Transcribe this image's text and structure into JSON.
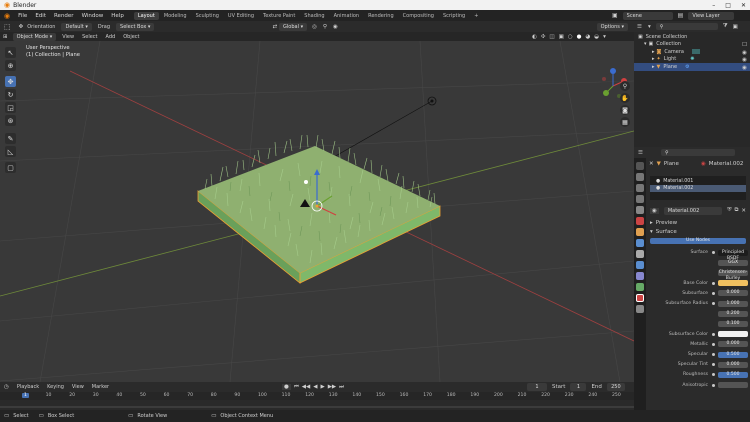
{
  "app": {
    "title": "Blender",
    "menus": [
      "File",
      "Edit",
      "Render",
      "Window",
      "Help"
    ],
    "workspaces": [
      "Layout",
      "Modeling",
      "Sculpting",
      "UV Editing",
      "Texture Paint",
      "Shading",
      "Animation",
      "Rendering",
      "Compositing",
      "Scripting"
    ],
    "active_workspace": "Layout",
    "add_workspace": "+",
    "scene": "Scene",
    "view_layer": "View Layer"
  },
  "viewport_header": {
    "orientation_label": "Orientation",
    "orientation_value": "Default",
    "drag_label": "Drag",
    "drag_value": "Select Box",
    "transform_value": "Global",
    "options": "Options",
    "mode": "Object Mode",
    "menus": [
      "View",
      "Select",
      "Add",
      "Object"
    ]
  },
  "viewport": {
    "perspective": "User Perspective",
    "collection_info": "(1) Collection | Plane"
  },
  "outliner": {
    "items": [
      {
        "label": "Scene Collection",
        "indent": 0
      },
      {
        "label": "Collection",
        "indent": 1
      },
      {
        "label": "Camera",
        "indent": 2
      },
      {
        "label": "Light",
        "indent": 2
      },
      {
        "label": "Plane",
        "indent": 2
      }
    ]
  },
  "properties": {
    "object_name": "Plane",
    "material_breadcrumb": "Material.002",
    "slots": [
      "Material.001",
      "Material.002"
    ],
    "material_name": "Material.002",
    "preview_label": "Preview",
    "surface_label": "Surface",
    "use_nodes": "Use Nodes",
    "rows": [
      {
        "label": "Surface",
        "value": "Principled BSDF",
        "style": "dark"
      },
      {
        "label": "",
        "value": "GGX",
        "style": "normal"
      },
      {
        "label": "",
        "value": "Christensen-Burley",
        "style": "normal"
      },
      {
        "label": "Base Color",
        "value": "",
        "style": "color"
      },
      {
        "label": "Subsurface",
        "value": "0.000",
        "style": "normal"
      },
      {
        "label": "Subsurface Radius",
        "value": "1.000",
        "style": "normal"
      },
      {
        "label": "",
        "value": "0.200",
        "style": "normal"
      },
      {
        "label": "",
        "value": "0.100",
        "style": "normal"
      },
      {
        "label": "Subsurface Color",
        "value": "",
        "style": "white"
      },
      {
        "label": "Metallic",
        "value": "0.000",
        "style": "normal"
      },
      {
        "label": "Specular",
        "value": "0.500",
        "style": "blue"
      },
      {
        "label": "Specular Tint",
        "value": "0.000",
        "style": "normal"
      },
      {
        "label": "Roughness",
        "value": "0.500",
        "style": "blue"
      },
      {
        "label": "Anisotropic",
        "value": "",
        "style": "normal"
      }
    ]
  },
  "timeline": {
    "menus": [
      "Playback",
      "Keying",
      "View",
      "Marker"
    ],
    "current_frame": "1",
    "start_label": "Start",
    "start": "1",
    "end_label": "End",
    "end": "250",
    "ticks": [
      "1",
      "10",
      "20",
      "30",
      "40",
      "50",
      "60",
      "70",
      "80",
      "90",
      "100",
      "110",
      "120",
      "130",
      "140",
      "150",
      "160",
      "170",
      "180",
      "190",
      "200",
      "210",
      "220",
      "230",
      "240",
      "250"
    ]
  },
  "statusbar": {
    "items": [
      "Select",
      "Box Select",
      "Rotate View",
      "Object Context Menu"
    ]
  },
  "colors": {
    "accent": "#4772b3",
    "grass": "#8fc27a",
    "base_color": "#f0c060"
  }
}
